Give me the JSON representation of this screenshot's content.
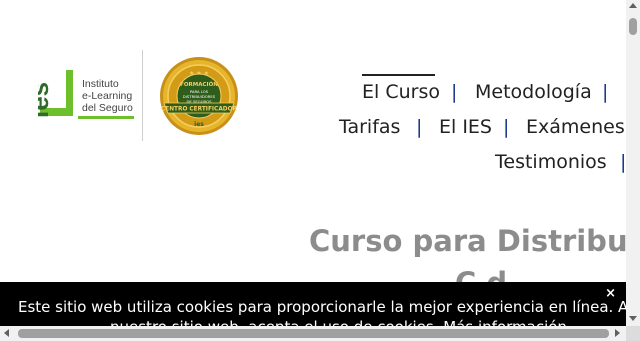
{
  "logo": {
    "letters": "ies",
    "name_lines": [
      "Instituto",
      "e-Learning",
      "del Seguro"
    ],
    "brand_color": "#6dbf2c"
  },
  "seal": {
    "top_text": "FORMACIÓN",
    "middle_lines": [
      "PARA LOS",
      "DISTRIBUIDORES",
      "DE SEGUROS"
    ],
    "ribbon_text": "CENTRO CERTIFICADOR",
    "bottom_text": "ies",
    "colors": {
      "gold": "#d9a41a",
      "green": "#3b6b1f"
    }
  },
  "nav": {
    "items": [
      {
        "label": "El Curso",
        "active": true
      },
      {
        "label": "Metodología"
      },
      {
        "label": "Tarifas"
      },
      {
        "label": "El IES"
      },
      {
        "label": "Exámenes d"
      },
      {
        "label": "Testimonios"
      }
    ],
    "separator": "|",
    "separator_color": "#1d3a8f"
  },
  "heading": {
    "line1": "Curso para Distribuid",
    "line2": "C            d"
  },
  "cookie_banner": {
    "text": "Este sitio web utiliza cookies para proporcionarle la mejor experiencia en línea. Al utilizar",
    "text2": "nuestro sitio web, acepta el uso de cookies.",
    "link": "Más información",
    "close": "×"
  }
}
